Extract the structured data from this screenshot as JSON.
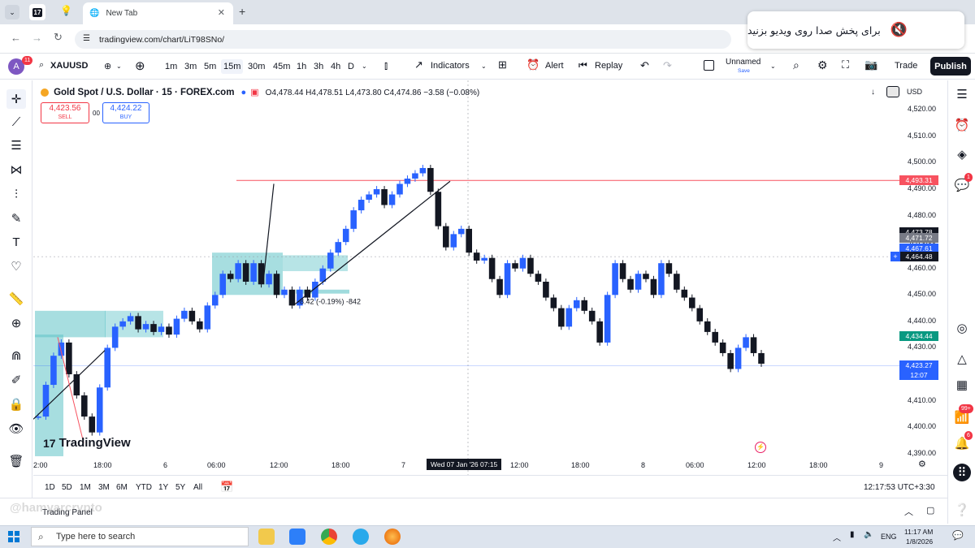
{
  "browser": {
    "tabs": [
      {
        "label": "New Tab"
      }
    ],
    "url": "tradingview.com/chart/LiT98SNo/"
  },
  "notice": {
    "text": "برای پخش صدا روی ویدیو بزنید"
  },
  "toolbar": {
    "avatar_letter": "A",
    "avatar_badge": "11",
    "symbol": "XAUUSD",
    "timeframes": [
      "1m",
      "3m",
      "5m",
      "15m",
      "30m",
      "45m",
      "1h",
      "3h",
      "4h",
      "D"
    ],
    "selected_timeframe": "15m",
    "indicators_label": "Indicators",
    "alert_label": "Alert",
    "replay_label": "Replay",
    "layout_name": "Unnamed",
    "layout_status": "Save",
    "trade_label": "Trade",
    "publish_label": "Publish"
  },
  "legend": {
    "title": "Gold Spot / U.S. Dollar · 15 · FOREX.com",
    "ohlc": "O4,478.44 H4,478.51 L4,473.80 C4,474.86 −3.58 (−0.08%)",
    "sell_price": "4,423.56",
    "sell_label": "SELL",
    "spread": "00",
    "buy_price": "4,424.22",
    "buy_label": "BUY",
    "currency": "USD"
  },
  "chart_data": {
    "type": "candlestick",
    "symbol": "XAUUSD",
    "ylim": [
      4385,
      4525
    ],
    "y_ticks": [
      "4,520.00",
      "4,510.00",
      "4,500.00",
      "4,490.00",
      "4,480.00",
      "4,470.00",
      "4,460.00",
      "4,450.00",
      "4,440.00",
      "4,430.00",
      "4,420.00",
      "4,410.00",
      "4,400.00",
      "4,390.00"
    ],
    "y_tick_values": [
      4520,
      4510,
      4500,
      4490,
      4480,
      4470,
      4460,
      4450,
      4440,
      4430,
      4420,
      4410,
      4400,
      4390
    ],
    "x_ticks": [
      "2:00",
      "18:00",
      "6",
      "06:00",
      "12:00",
      "18:00",
      "7",
      "12:00",
      "18:00",
      "8",
      "06:00",
      "12:00",
      "18:00",
      "9"
    ],
    "crosshair_time": "Wed 07 Jan '26  07:15",
    "close_series": [
      4404,
      4416,
      4427,
      4432,
      4420,
      4412,
      4404,
      4398,
      4415,
      4430,
      4438,
      4440,
      4442,
      4437,
      4439,
      4436,
      4438,
      4435,
      4441,
      4444,
      4440,
      4437,
      4446,
      4450,
      4458,
      4456,
      4462,
      4455,
      4462,
      4454,
      4458,
      4450,
      4452,
      4446,
      4452,
      4449,
      4455,
      4460,
      4466,
      4470,
      4475,
      4482,
      4486,
      4488,
      4490,
      4484,
      4488,
      4492,
      4494,
      4496,
      4498,
      4489,
      4476,
      4468,
      4473,
      4475,
      4466,
      4463,
      4464,
      4456,
      4450,
      4462,
      4460,
      4464,
      4458,
      4455,
      4449,
      4445,
      4438,
      4445,
      4448,
      4444,
      4440,
      4432,
      4450,
      4462,
      4456,
      4452,
      4458,
      4456,
      4450,
      4462,
      4458,
      4452,
      4449,
      4445,
      4440,
      4436,
      4432,
      4428,
      4422,
      4430,
      4434,
      4428,
      4424
    ],
    "price_labels": [
      {
        "value": 4493.31,
        "text": "4,493.31",
        "color": "#f7525f"
      },
      {
        "value": 4473.78,
        "text": "4,473.78",
        "color": "#131722"
      },
      {
        "value": 4471.72,
        "text": "4,471.72",
        "color": "#787b86"
      },
      {
        "value": 4467.61,
        "text": "4,467.61",
        "color": "#2962ff"
      },
      {
        "value": 4464.48,
        "text": "4,464.48",
        "color": "#131722"
      },
      {
        "value": 4434.44,
        "text": "4,434.44",
        "color": "#089981"
      },
      {
        "value": 4423.27,
        "text": "4,423.27",
        "color": "#2962ff"
      }
    ],
    "countdown": "12:07",
    "horizontal_line": 4493.31,
    "measure_label": "-8.42 (-0.19%) -842",
    "zones_color": "#5fc3c7"
  },
  "rangebar": {
    "ranges": [
      "1D",
      "5D",
      "1M",
      "3M",
      "6M",
      "YTD",
      "1Y",
      "5Y",
      "All"
    ],
    "clock": "12:17:53 UTC+3:30"
  },
  "trading_panel": {
    "label": "Trading Panel"
  },
  "watermark": {
    "text": "@hamyarcrypto"
  },
  "branding": {
    "tv_logo": "TradingView"
  },
  "taskbar": {
    "search_placeholder": "Type here to search",
    "lang": "ENG",
    "time": "11:17 AM",
    "date": "1/8/2026"
  },
  "right_panel": {
    "alerts_badge": "1",
    "feed_badge": "99+",
    "notif_badge": "6"
  }
}
